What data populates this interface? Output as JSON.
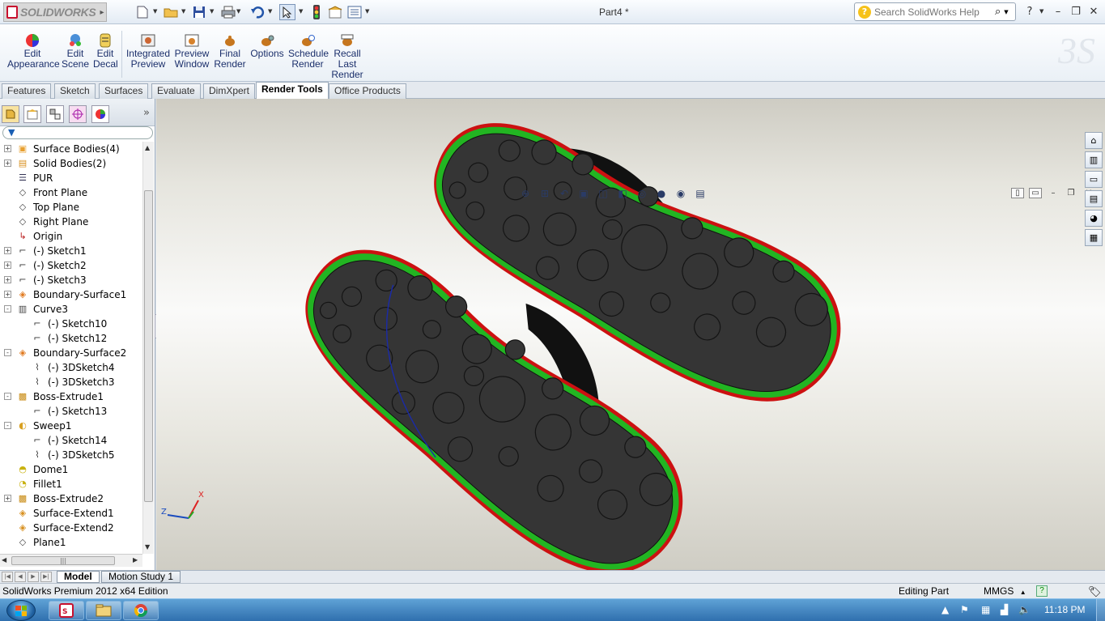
{
  "titlebar": {
    "app_name": "SOLIDWORKS",
    "doc_title": "Part4 *",
    "search_placeholder": "Search SolidWorks Help",
    "help_label": "?"
  },
  "ribbon": {
    "buttons": [
      {
        "id": "edit-appearance",
        "line1": "Edit",
        "line2": "Appearance",
        "line3": ""
      },
      {
        "id": "edit-scene",
        "line1": "Edit",
        "line2": "Scene",
        "line3": ""
      },
      {
        "id": "edit-decal",
        "line1": "Edit",
        "line2": "Decal",
        "line3": ""
      },
      {
        "id": "integrated-preview",
        "line1": "Integrated",
        "line2": "Preview",
        "line3": ""
      },
      {
        "id": "preview-window",
        "line1": "Preview",
        "line2": "Window",
        "line3": ""
      },
      {
        "id": "final-render",
        "line1": "Final",
        "line2": "Render",
        "line3": ""
      },
      {
        "id": "options",
        "line1": "Options",
        "line2": "",
        "line3": ""
      },
      {
        "id": "schedule-render",
        "line1": "Schedule",
        "line2": "Render",
        "line3": ""
      },
      {
        "id": "recall-last-render",
        "line1": "Recall",
        "line2": "Last",
        "line3": "Render"
      }
    ]
  },
  "tabs": [
    "Features",
    "Sketch",
    "Surfaces",
    "Evaluate",
    "DimXpert",
    "Render Tools",
    "Office Products"
  ],
  "active_tab": "Render Tools",
  "tree": [
    {
      "label": "Surface Bodies(4)",
      "indent": 0,
      "expander": "+",
      "icon": "surface-bodies-icon"
    },
    {
      "label": "Solid Bodies(2)",
      "indent": 0,
      "expander": "+",
      "icon": "solid-bodies-icon"
    },
    {
      "label": "PUR",
      "indent": 0,
      "expander": "",
      "icon": "material-icon"
    },
    {
      "label": "Front Plane",
      "indent": 0,
      "expander": "",
      "icon": "plane-icon"
    },
    {
      "label": "Top Plane",
      "indent": 0,
      "expander": "",
      "icon": "plane-icon"
    },
    {
      "label": "Right Plane",
      "indent": 0,
      "expander": "",
      "icon": "plane-icon"
    },
    {
      "label": "Origin",
      "indent": 0,
      "expander": "",
      "icon": "origin-icon"
    },
    {
      "label": "(-) Sketch1",
      "indent": 0,
      "expander": "+",
      "icon": "sketch-icon"
    },
    {
      "label": "(-) Sketch2",
      "indent": 0,
      "expander": "+",
      "icon": "sketch-icon"
    },
    {
      "label": "(-) Sketch3",
      "indent": 0,
      "expander": "+",
      "icon": "sketch-icon"
    },
    {
      "label": "Boundary-Surface1",
      "indent": 0,
      "expander": "+",
      "icon": "boundary-surface-icon"
    },
    {
      "label": "Curve3",
      "indent": 0,
      "expander": "-",
      "icon": "curve-icon"
    },
    {
      "label": "(-) Sketch10",
      "indent": 1,
      "expander": "",
      "icon": "sketch-icon"
    },
    {
      "label": "(-) Sketch12",
      "indent": 1,
      "expander": "",
      "icon": "sketch-icon"
    },
    {
      "label": "Boundary-Surface2",
      "indent": 0,
      "expander": "-",
      "icon": "boundary-surface-icon"
    },
    {
      "label": "(-) 3DSketch4",
      "indent": 1,
      "expander": "",
      "icon": "3dsketch-icon"
    },
    {
      "label": "(-) 3DSketch3",
      "indent": 1,
      "expander": "",
      "icon": "3dsketch-icon"
    },
    {
      "label": "Boss-Extrude1",
      "indent": 0,
      "expander": "-",
      "icon": "boss-extrude-icon"
    },
    {
      "label": "(-) Sketch13",
      "indent": 1,
      "expander": "",
      "icon": "sketch-icon"
    },
    {
      "label": "Sweep1",
      "indent": 0,
      "expander": "-",
      "icon": "sweep-icon"
    },
    {
      "label": "(-) Sketch14",
      "indent": 1,
      "expander": "",
      "icon": "sketch-icon"
    },
    {
      "label": "(-) 3DSketch5",
      "indent": 1,
      "expander": "",
      "icon": "3dsketch-icon"
    },
    {
      "label": "Dome1",
      "indent": 0,
      "expander": "",
      "icon": "dome-icon"
    },
    {
      "label": "Fillet1",
      "indent": 0,
      "expander": "",
      "icon": "fillet-icon"
    },
    {
      "label": "Boss-Extrude2",
      "indent": 0,
      "expander": "+",
      "icon": "boss-extrude-icon"
    },
    {
      "label": "Surface-Extend1",
      "indent": 0,
      "expander": "",
      "icon": "surface-extend-icon"
    },
    {
      "label": "Surface-Extend2",
      "indent": 0,
      "expander": "",
      "icon": "surface-extend-icon"
    },
    {
      "label": "Plane1",
      "indent": 0,
      "expander": "",
      "icon": "plane-icon"
    }
  ],
  "triad": {
    "x": "X",
    "z": "Z"
  },
  "bottom_tabs": [
    "Model",
    "Motion Study 1"
  ],
  "active_bottom_tab": "Model",
  "status": {
    "edition": "SolidWorks Premium 2012 x64 Edition",
    "mode": "Editing Part",
    "units": "MMGS",
    "units_arrow": "▲"
  },
  "taskbar": {
    "apps": [
      "solidworks-app-icon",
      "explorer-app-icon",
      "chrome-app-icon"
    ],
    "clock": "11:18 PM"
  },
  "colors": {
    "sole": "#353535",
    "rim_green": "#22b522",
    "rim_red": "#cc1111",
    "strap": "#111111",
    "sketch_line": "#1a2aa8"
  }
}
